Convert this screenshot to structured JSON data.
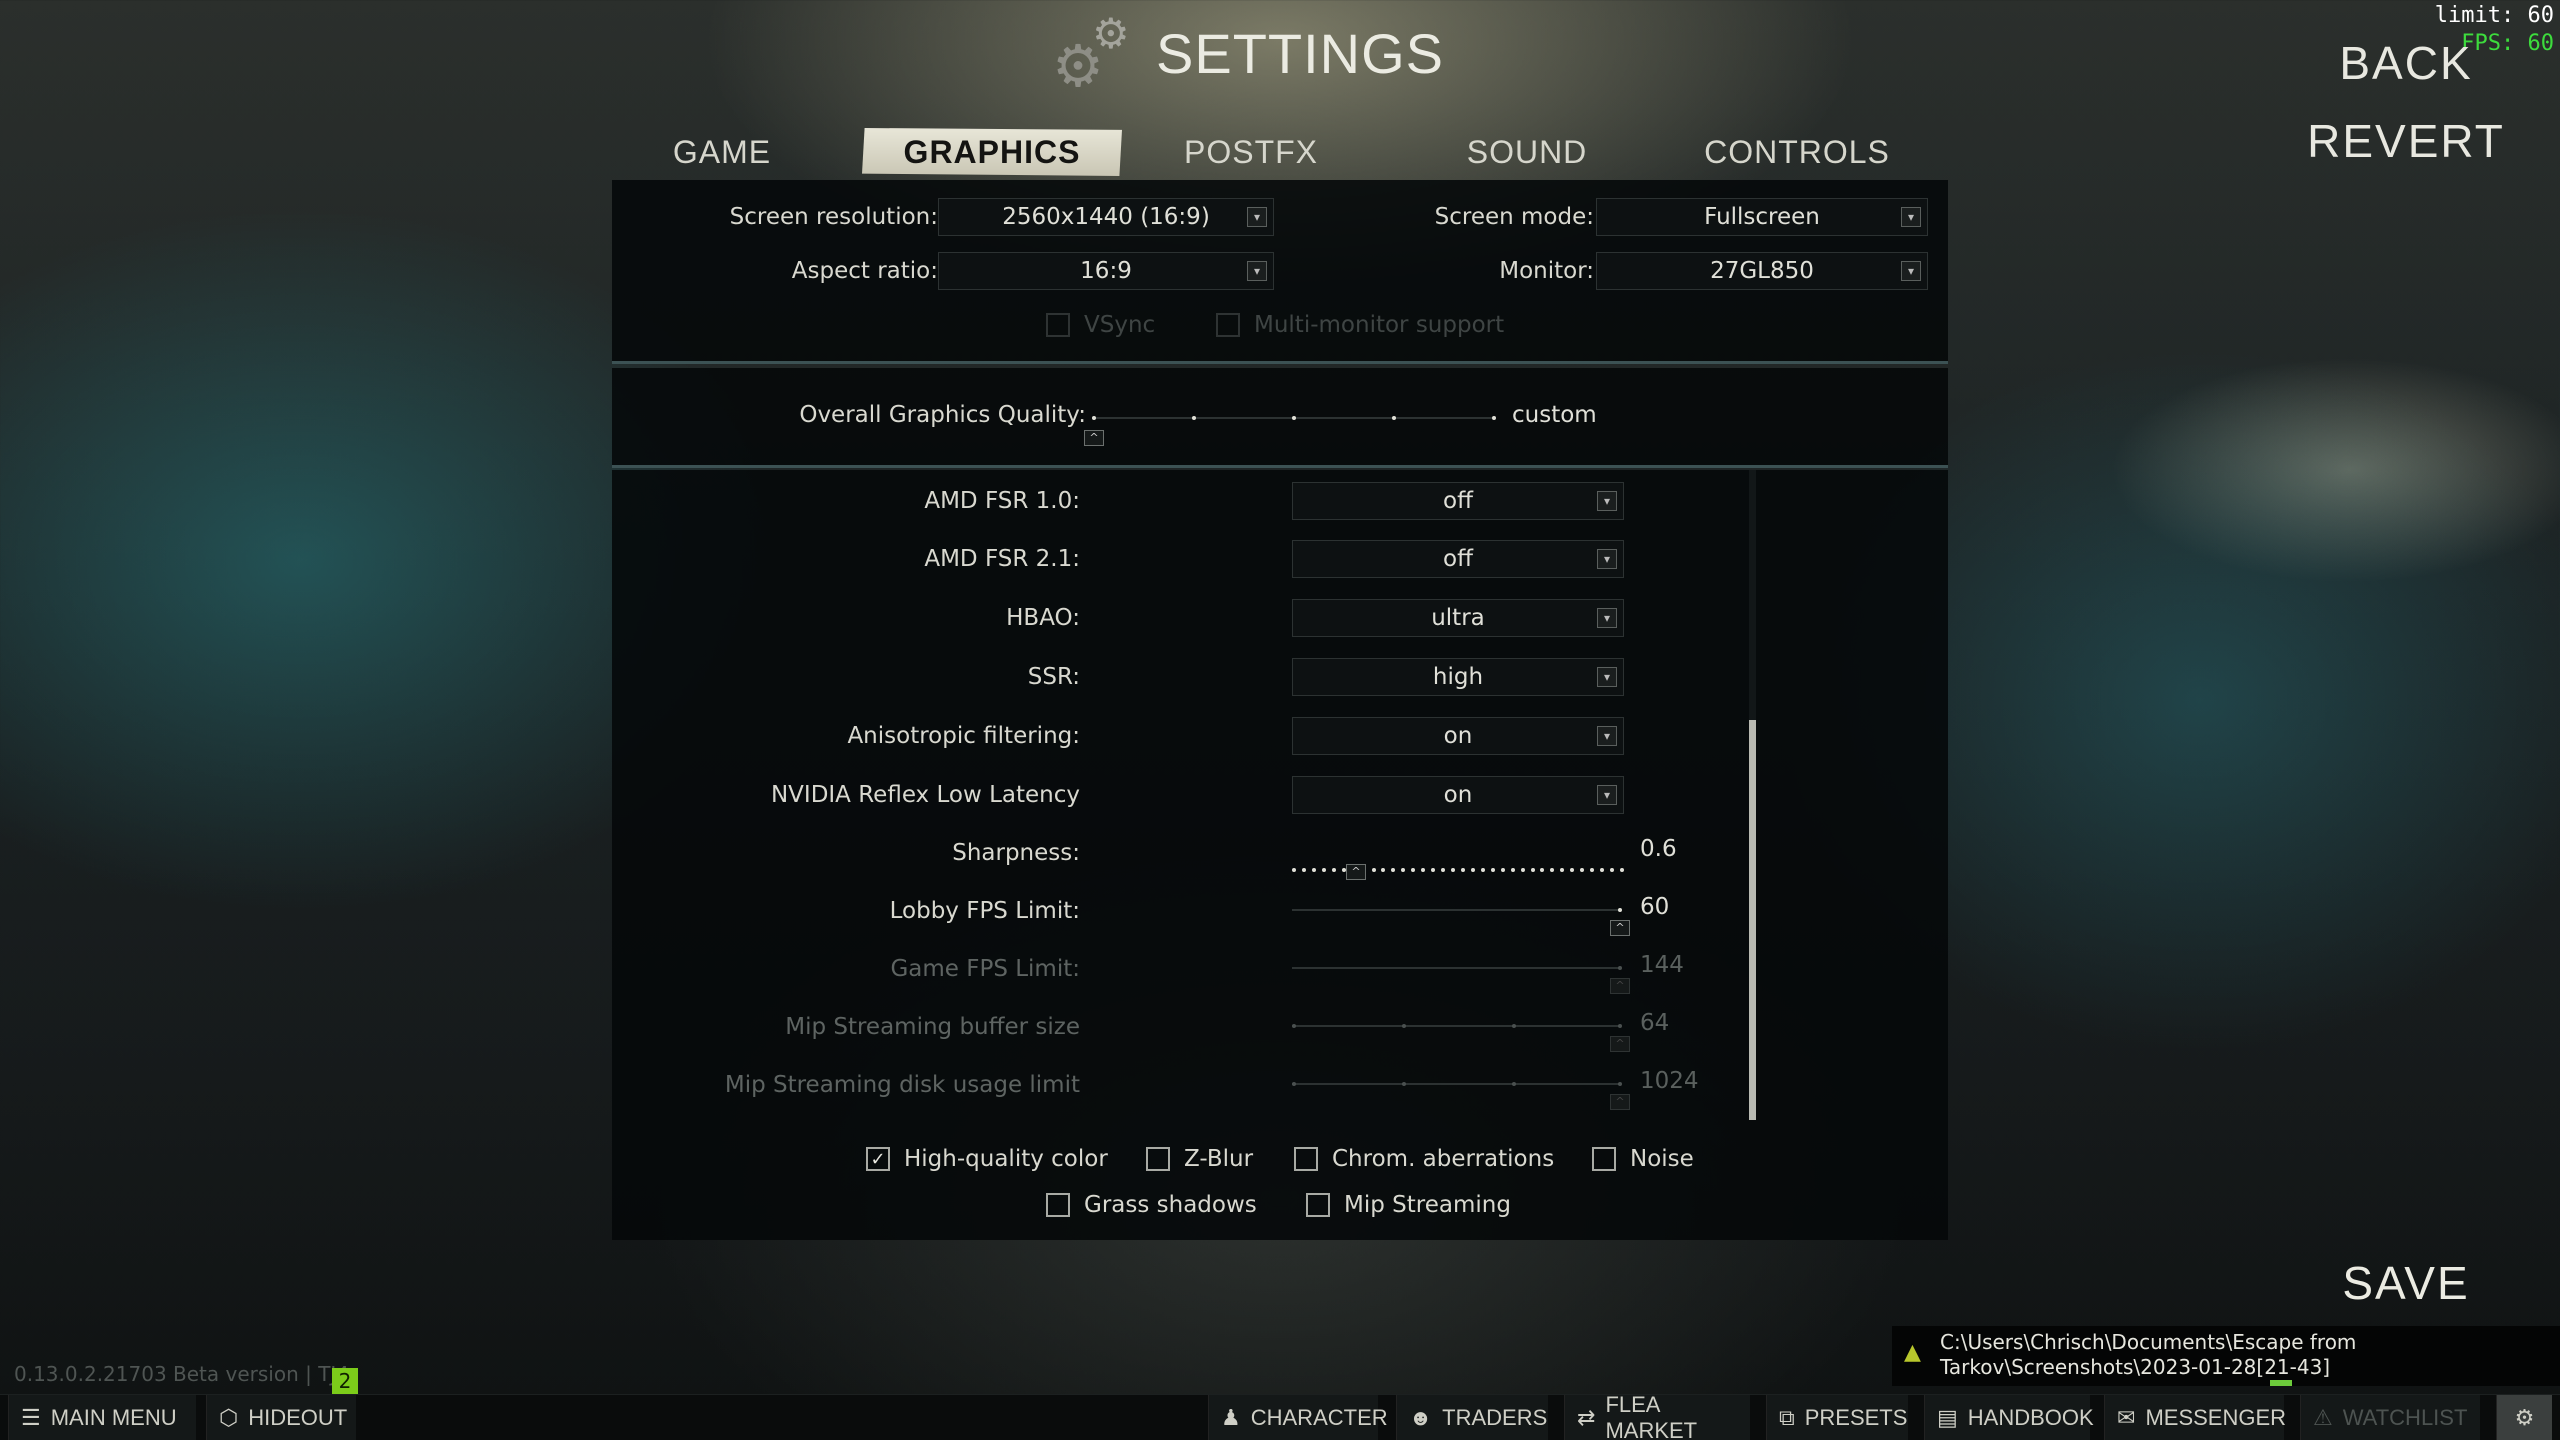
{
  "title": {
    "text": "SETTINGS",
    "icon": "gears-icon"
  },
  "side_actions": {
    "back": "BACK",
    "revert": "REVERT"
  },
  "fps_overlay": {
    "limit": "limit: 60",
    "fps": "FPS: 60"
  },
  "tabs": [
    {
      "label": "GAME",
      "active": false
    },
    {
      "label": "GRAPHICS",
      "active": true
    },
    {
      "label": "POSTFX",
      "active": false
    },
    {
      "label": "SOUND",
      "active": false
    },
    {
      "label": "CONTROLS",
      "active": false
    }
  ],
  "display": {
    "screen_resolution": {
      "label": "Screen resolution:",
      "value": "2560x1440 (16:9)"
    },
    "screen_mode": {
      "label": "Screen mode:",
      "value": "Fullscreen"
    },
    "aspect_ratio": {
      "label": "Aspect ratio:",
      "value": "16:9"
    },
    "monitor": {
      "label": "Monitor:",
      "value": "27GL850"
    },
    "vsync": {
      "label": "VSync",
      "checked": false,
      "enabled": false
    },
    "multi_monitor": {
      "label": "Multi-monitor support",
      "checked": false,
      "enabled": false
    }
  },
  "quality": {
    "label": "Overall Graphics Quality:",
    "value": "custom",
    "steps": 5,
    "level_index": 0
  },
  "settings": {
    "amd_fsr_10": {
      "label": "AMD FSR 1.0:",
      "value": "off"
    },
    "amd_fsr_21": {
      "label": "AMD FSR 2.1:",
      "value": "off"
    },
    "hbao": {
      "label": "HBAO:",
      "value": "ultra"
    },
    "ssr": {
      "label": "SSR:",
      "value": "high"
    },
    "aniso": {
      "label": "Anisotropic filtering:",
      "value": "on"
    },
    "reflex": {
      "label": "NVIDIA Reflex Low Latency",
      "value": "on"
    }
  },
  "sliders": {
    "sharpness": {
      "label": "Sharpness:",
      "value": "0.6",
      "fraction": 0.2
    },
    "lobby_fps": {
      "label": "Lobby FPS Limit:",
      "value": "60",
      "fraction": 1.0
    },
    "game_fps": {
      "label": "Game FPS Limit:",
      "value": "144",
      "fraction": 1.0
    },
    "mip_buffer": {
      "label": "Mip Streaming buffer size",
      "value": "64",
      "fraction": 1.0
    },
    "mip_disk": {
      "label": "Mip Streaming disk usage limit",
      "value": "1024",
      "fraction": 1.0
    }
  },
  "checkboxes": {
    "hq_color": {
      "label": "High-quality color",
      "checked": true
    },
    "z_blur": {
      "label": "Z-Blur",
      "checked": false
    },
    "chrom_aberr": {
      "label": "Chrom. aberrations",
      "checked": false
    },
    "noise": {
      "label": "Noise",
      "checked": false
    },
    "grass_shadows": {
      "label": "Grass shadows",
      "checked": false
    },
    "mip_streaming": {
      "label": "Mip Streaming",
      "checked": false
    }
  },
  "save": "SAVE",
  "notification": {
    "line1": "C:\\Users\\Chrisch\\Documents\\Escape from",
    "line2": "Tarkov\\Screenshots\\2023-01-28[21-43]"
  },
  "version": {
    "text": "0.13.0.2.21703 Beta version | TJ4",
    "badge": "2"
  },
  "bottom_nav": {
    "main_menu": "MAIN MENU",
    "hideout": "HIDEOUT",
    "character": "CHARACTER",
    "traders": "TRADERS",
    "flea_market": "FLEA MARKET",
    "presets": "PRESETS",
    "handbook": "HANDBOOK",
    "messenger": "MESSENGER",
    "watchlist": "WATCHLIST"
  },
  "colors": {
    "accent_green": "#7ccc1a",
    "fps_green": "#3ddc3d",
    "active_tab_bg": "#e8e6d8"
  }
}
